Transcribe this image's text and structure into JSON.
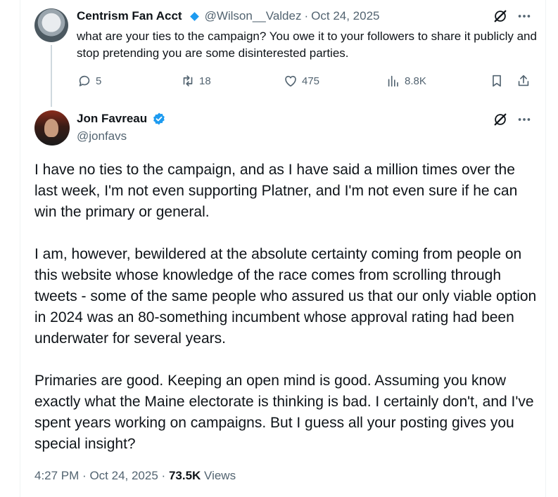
{
  "parent_tweet": {
    "display_name": "Centrism Fan Acct",
    "handle": "@Wilson__Valdez",
    "separator": "·",
    "date": "Oct 24, 2025",
    "text": "what are your ties to the campaign? You owe it to your followers to share it publicly and stop pretending you are some disinterested parties.",
    "reply_count": "5",
    "repost_count": "18",
    "like_count": "475",
    "view_count": "8.8K"
  },
  "main_tweet": {
    "display_name": "Jon Favreau",
    "handle": "@jonfavs",
    "paragraphs": [
      "I have no ties to the campaign, and as I have said a million times over the last week, I'm not even supporting Platner, and I'm not even sure if he can win the primary or general.",
      "I am, however, bewildered at the absolute certainty coming from people on this website whose knowledge of the race comes from scrolling through tweets - some of the same people who assured us that our only viable option in 2024 was an 80-something incumbent whose approval rating had been underwater for several years.",
      "Primaries are good. Keeping an open mind is good. Assuming you know exactly what the Maine electorate is thinking is bad. I certainly don't, and I've spent years working on campaigns. But I guess all your posting gives you special insight?"
    ],
    "time": "4:27 PM",
    "separator": "·",
    "date": "Oct 24, 2025",
    "views_count": "73.5K",
    "views_label": "Views"
  },
  "colors": {
    "accent": "#1d9bf0",
    "text": "#0f1419",
    "muted": "#536471",
    "thread_line": "#cfd9de"
  },
  "icons": [
    "grok-icon",
    "more-icon",
    "reply-icon",
    "repost-icon",
    "like-icon",
    "views-icon",
    "bookmark-icon",
    "share-icon",
    "verified-badge-icon"
  ]
}
